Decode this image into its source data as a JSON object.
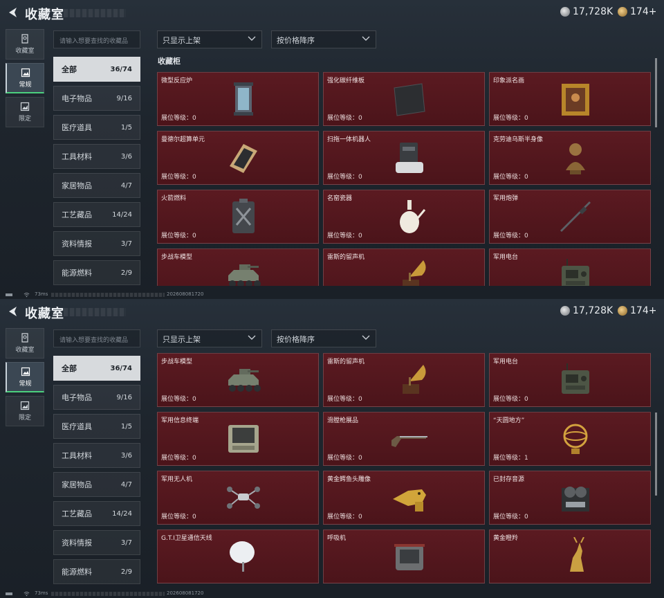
{
  "title": "收藏室",
  "currency": {
    "silver": "17,728K",
    "gold": "174",
    "plus": "+"
  },
  "side_tabs": [
    {
      "label": "收藏室",
      "icon": "collection-room-icon"
    },
    {
      "label": "常规",
      "icon": "image-frame-icon"
    },
    {
      "label": "限定",
      "icon": "limited-image-icon"
    }
  ],
  "search_placeholder": "请输入想要查找的收藏品",
  "filter_dropdown": "只显示上架",
  "sort_dropdown": "按价格降序",
  "categories": [
    {
      "name": "全部",
      "count": "36/74"
    },
    {
      "name": "电子物品",
      "count": "9/16"
    },
    {
      "name": "医疗道具",
      "count": "1/5"
    },
    {
      "name": "工具材料",
      "count": "3/6"
    },
    {
      "name": "家居物品",
      "count": "4/7"
    },
    {
      "name": "工艺藏品",
      "count": "14/24"
    },
    {
      "name": "资料情报",
      "count": "3/7"
    },
    {
      "name": "能源燃料",
      "count": "2/9"
    }
  ],
  "section_title": "收藏柜",
  "level_label": "展位等级：",
  "items": [
    {
      "name": "微型反应炉",
      "level": "0",
      "icon": "mini-reactor-icon"
    },
    {
      "name": "强化碳纤维板",
      "level": "0",
      "icon": "carbon-fiber-plate-icon"
    },
    {
      "name": "印象派名画",
      "level": "0",
      "icon": "framed-painting-icon"
    },
    {
      "name": "曼德尔超算单元",
      "level": "0",
      "icon": "supercomputer-unit-icon"
    },
    {
      "name": "扫拖一体机器人",
      "level": "0",
      "icon": "mop-robot-icon"
    },
    {
      "name": "克劳迪乌斯半身像",
      "level": "0",
      "icon": "bust-statue-icon"
    },
    {
      "name": "火箭燃料",
      "level": "0",
      "icon": "fuel-canister-icon"
    },
    {
      "name": "名窑瓷器",
      "level": "0",
      "icon": "porcelain-vase-icon"
    },
    {
      "name": "军用炮弹",
      "level": "0",
      "icon": "artillery-shell-icon"
    },
    {
      "name": "步战车模型",
      "level": "0",
      "icon": "ifv-model-icon"
    },
    {
      "name": "雷斯的留声机",
      "level": "0",
      "icon": "gramophone-icon"
    },
    {
      "name": "军用电台",
      "level": "0",
      "icon": "military-radio-icon"
    },
    {
      "name": "军用信息终端",
      "level": "0",
      "icon": "info-terminal-icon"
    },
    {
      "name": "滑膛枪展品",
      "level": "0",
      "icon": "musket-icon"
    },
    {
      "name": "“天圆地方”",
      "level": "1",
      "icon": "armillary-sphere-icon"
    },
    {
      "name": "军用无人机",
      "level": "0",
      "icon": "drone-icon"
    },
    {
      "name": "黄金鳄鱼头雕像",
      "level": "0",
      "icon": "gold-crocodile-icon"
    },
    {
      "name": "已封存音源",
      "level": "0",
      "icon": "reel-recorder-icon"
    },
    {
      "name": "G.T.I卫星通信天线",
      "level": "",
      "icon": "satellite-dish-icon"
    },
    {
      "name": "呼吸机",
      "level": "",
      "icon": "ventilator-icon"
    },
    {
      "name": "黄金瞪羚",
      "level": "",
      "icon": "gold-gazelle-icon"
    }
  ],
  "status": {
    "ping": "73ms",
    "build": "202608081720"
  },
  "colors": {
    "card_bg": "#561820",
    "active_tab_accent": "#4bd07d",
    "active_category_bg": "#d7dadd"
  }
}
